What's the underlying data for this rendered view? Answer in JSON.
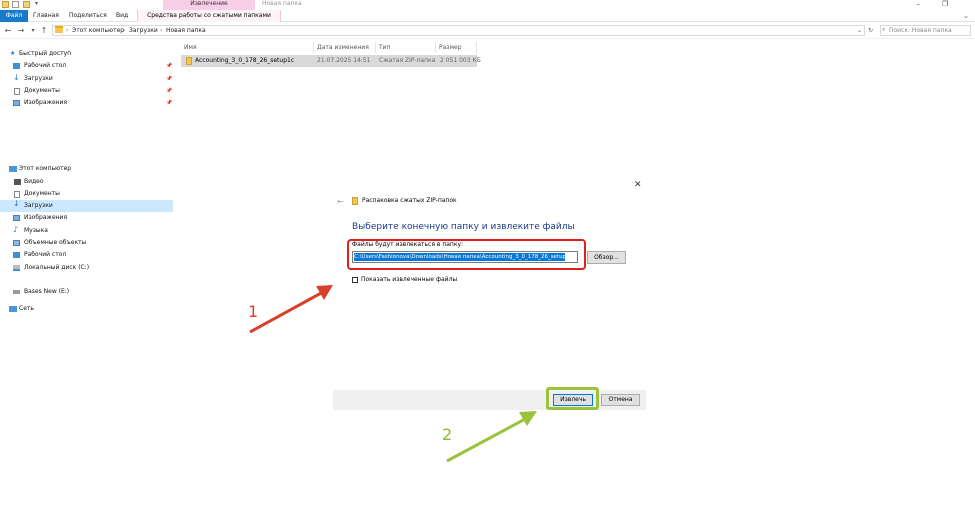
{
  "titlebar": {
    "context_tab_title": "Извлечение",
    "window_title": "Новая папка"
  },
  "ribbon": {
    "tabs": [
      "Файл",
      "Главная",
      "Поделиться",
      "Вид"
    ],
    "context_tab": "Средства работы со сжатыми папками"
  },
  "address": {
    "crumbs": [
      "Этот компьютер",
      "Загрузки",
      "Новая папка"
    ],
    "search_placeholder": "Поиск: Новая папка"
  },
  "sidebar": {
    "quick_access": "Быстрый доступ",
    "quick_items": [
      "Рабочий стол",
      "Загрузки",
      "Документы",
      "Изображения"
    ],
    "this_pc": "Этот компьютер",
    "pc_items": [
      "Видео",
      "Документы",
      "Загрузки",
      "Изображения",
      "Музыка",
      "Объемные объекты",
      "Рабочий стол",
      "Локальный диск (C:)"
    ],
    "drive": "Bases New (E:)",
    "network": "Сеть"
  },
  "file_list": {
    "columns": [
      "Имя",
      "Дата изменения",
      "Тип",
      "Размер"
    ],
    "rows": [
      {
        "name": "Accounting_3_0_178_26_setup1c",
        "date": "21.07.2025 14:51",
        "type": "Сжатая ZIP-папка",
        "size": "2 051 003 КБ"
      }
    ]
  },
  "dialog": {
    "title": "Распаковка сжатых ZIP-папок",
    "heading": "Выберите конечную папку и извлеките файлы",
    "path_label": "Файлы будут извлекаться в папку:",
    "path_value": "C:\\Users\\Fashionova\\Downloads\\Новая папка\\Accounting_3_0_178_26_setup1c",
    "browse_label": "Обзор...",
    "checkbox_label": "Показать извлеченные файлы",
    "extract_label": "Извлечь",
    "cancel_label": "Отмена"
  },
  "annotations": {
    "step1": "1",
    "step2": "2",
    "colors": {
      "red": "#e0201b",
      "green": "#9ac23c"
    }
  },
  "icons": {
    "close": "close-icon",
    "back": "arrow-left-icon",
    "folder": "folder-icon",
    "zip": "zip-folder-icon"
  }
}
